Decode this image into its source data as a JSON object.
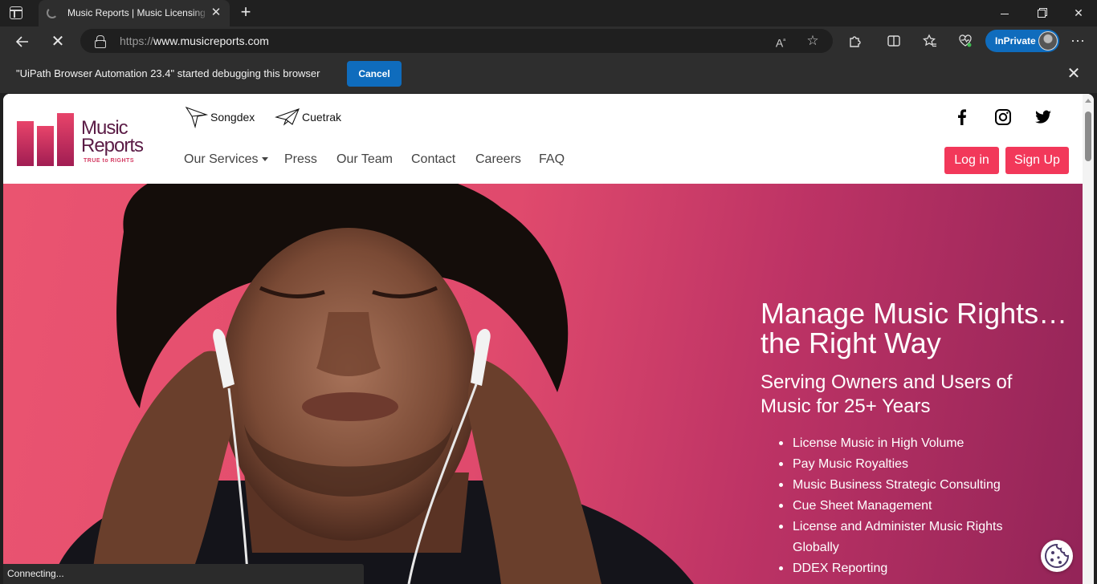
{
  "browser": {
    "tab_title": "Music Reports | Music Licensing & Royalty Administration",
    "url_scheme": "https://",
    "url_host": "www.musicreports.com",
    "inprivate_label": "InPrivate",
    "infobar_text": "\"UiPath Browser Automation 23.4\" started debugging this browser",
    "infobar_cancel": "Cancel",
    "status_text": "Connecting...",
    "icons": {
      "back": "back-arrow-icon",
      "stop": "stop-loading-icon",
      "lock": "lock-icon",
      "read_aloud": "read-aloud-icon",
      "favorite": "star-icon",
      "extensions": "puzzle-icon",
      "split": "split-screen-icon",
      "favorites": "favorites-icon",
      "performance": "heart-pulse-icon",
      "more": "ellipsis-icon"
    }
  },
  "site": {
    "logo": {
      "line1": "Music",
      "line2": "Reports",
      "tagline": "TRUE to RIGHTS"
    },
    "brands": [
      {
        "label": "Songdex"
      },
      {
        "label": "Cuetrak"
      }
    ],
    "nav": {
      "services": "Our Services",
      "press": "Press",
      "team": "Our Team",
      "contact": "Contact",
      "careers": "Careers",
      "faq": "FAQ"
    },
    "social": [
      "facebook-icon",
      "instagram-icon",
      "twitter-icon"
    ],
    "login": "Log in",
    "signup": "Sign Up",
    "hero": {
      "title": "Manage Music Rights… the Right Way",
      "subtitle": "Serving Owners and Users of Music for 25+ Years",
      "list": [
        "License Music in High Volume",
        "Pay Music Royalties",
        "Music Business Strategic Consulting",
        "Cue Sheet Management",
        "License and Administer Music Rights Globally",
        "DDEX Reporting"
      ]
    },
    "colors": {
      "brand_pink": "#f2385a",
      "logo_purple": "#5b1c46",
      "hero_start": "#ea5470",
      "hero_end": "#932458",
      "edge_blue": "#0f6cbd"
    }
  }
}
